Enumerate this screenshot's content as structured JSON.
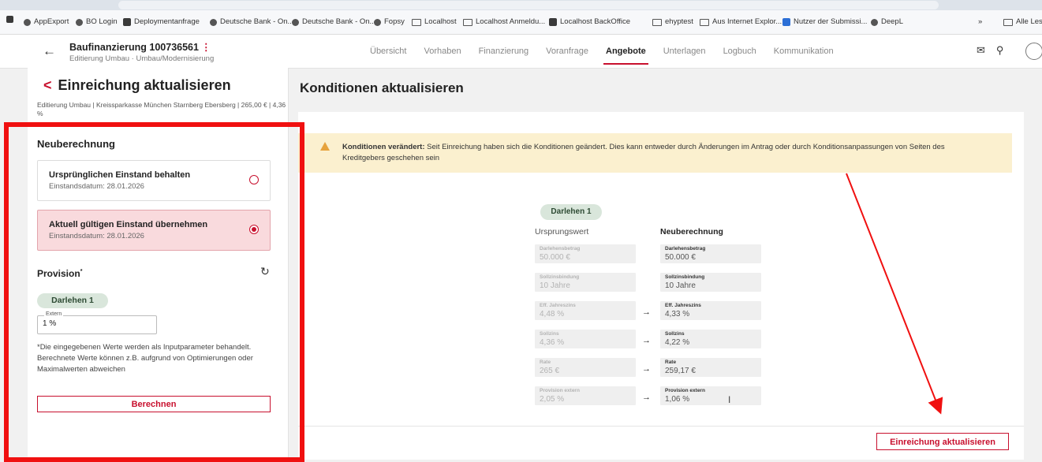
{
  "browser": {
    "bookmarks": [
      {
        "label": "AppExport",
        "icon": "globe-icon"
      },
      {
        "label": "BO Login",
        "icon": "globe-icon"
      },
      {
        "label": "Deploymentanfrage",
        "icon": "app-icon"
      },
      {
        "label": "Deutsche Bank - On...",
        "icon": "globe-icon"
      },
      {
        "label": "Deutsche Bank - On...",
        "icon": "globe-icon"
      },
      {
        "label": "Fopsy",
        "icon": "globe-icon"
      },
      {
        "label": "Localhost",
        "icon": "folder-icon"
      },
      {
        "label": "Localhost Anmeldu...",
        "icon": "folder-icon"
      },
      {
        "label": "Localhost BackOffice",
        "icon": "app-icon"
      },
      {
        "label": "ehyptest",
        "icon": "folder-icon"
      },
      {
        "label": "Aus Internet Explor...",
        "icon": "folder-icon"
      },
      {
        "label": "Nutzer der Submissi...",
        "icon": "app-icon"
      },
      {
        "label": "DeepL",
        "icon": "globe-icon"
      }
    ],
    "more": "»",
    "all_bookmarks": "Alle Les"
  },
  "header": {
    "title": "Baufinanzierung 100736561",
    "menu_glyph": "⋮",
    "subtitle": "Editierung Umbau · Umbau/Modernisierung",
    "tabs": [
      "Übersicht",
      "Vorhaben",
      "Finanzierung",
      "Voranfrage",
      "Angebote",
      "Unterlagen",
      "Logbuch",
      "Kommunikation"
    ],
    "active_tab": "Angebote"
  },
  "left": {
    "title": "Einreichung aktualisieren",
    "meta": "Editierung Umbau | Kreissparkasse München Starnberg Ebersberg | 265,00 € | 4,36 %",
    "neuberechnung_heading": "Neuberechnung",
    "option1_title": "Ursprünglichen Einstand behalten",
    "option1_sub": "Einstandsdatum: 28.01.2026",
    "option2_title": "Aktuell gültigen Einstand übernehmen",
    "option2_sub": "Einstandsdatum: 28.01.2026",
    "selected_option": 2,
    "provision_heading": "Provision",
    "provision_marker": "*",
    "loan_chip": "Darlehen 1",
    "extern_label": "Extern",
    "extern_value": "1 %",
    "note": "*Die eingegebenen Werte werden als Inputparameter behandelt. Berechnete Werte können z.B. aufgrund von Optimierungen oder Maximalwerten abweichen",
    "calc_button": "Berechnen"
  },
  "main": {
    "title": "Konditionen aktualisieren",
    "alert_bold": "Konditionen verändert:",
    "alert_text": " Seit Einreichung haben sich die Konditionen geändert. Dies kann entweder durch Änderungen im Antrag oder durch Konditionsanpassungen von Seiten des Kreditgebers geschehen sein",
    "loan_chip": "Darlehen 1",
    "col_original": "Ursprungswert",
    "col_new": "Neuberechnung",
    "rows": [
      {
        "label": "Darlehensbetrag",
        "orig": "50.000 €",
        "neu": "50.000 €",
        "arrow": false
      },
      {
        "label": "Sollzinsbindung",
        "orig": "10 Jahre",
        "neu": "10 Jahre",
        "arrow": false
      },
      {
        "label": "Eff. Jahreszins",
        "orig": "4,48 %",
        "neu": "4,33 %",
        "arrow": true
      },
      {
        "label": "Sollzins",
        "orig": "4,36 %",
        "neu": "4,22 %",
        "arrow": true
      },
      {
        "label": "Rate",
        "orig": "265 €",
        "neu": "259,17 €",
        "arrow": true
      },
      {
        "label": "Provision extern",
        "orig": "2,05 %",
        "neu": "1,06 %",
        "arrow": true
      }
    ],
    "arrow_glyph": "→",
    "update_button": "Einreichung aktualisieren"
  },
  "colors": {
    "accent": "#c8102e",
    "selected_bg": "#f9dadd",
    "alert_bg": "#fbf0cf",
    "chip_bg": "#d9e6db",
    "annotation": "#f01010"
  }
}
